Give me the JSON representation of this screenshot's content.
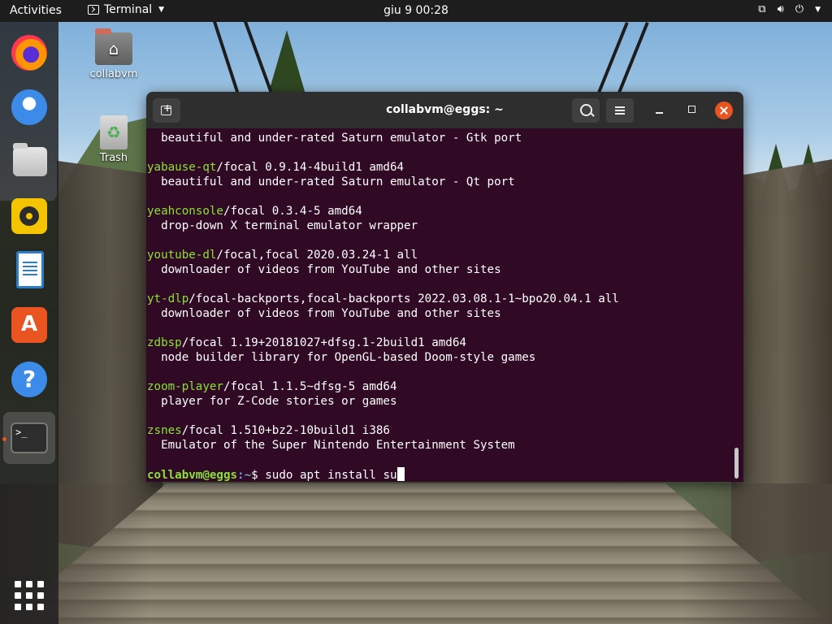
{
  "topbar": {
    "activities": "Activities",
    "app_name": "Terminal",
    "clock": "giu 9  00:28"
  },
  "dock": {
    "items": [
      "firefox-icon",
      "thunderbird-icon",
      "files-icon",
      "rhythmbox-icon",
      "libreoffice-writer-icon",
      "ubuntu-software-icon",
      "help-icon",
      "terminal-icon"
    ],
    "active": "terminal-icon"
  },
  "desktop": {
    "home_label": "collabvm",
    "trash_label": "Trash"
  },
  "terminal": {
    "title": "collabvm@eggs: ~",
    "lines": [
      {
        "pkg": "",
        "rest": "  beautiful and under-rated Saturn emulator - Gtk port"
      },
      {
        "pkg": "",
        "rest": ""
      },
      {
        "pkg": "yabause-qt",
        "rest": "/focal 0.9.14-4build1 amd64"
      },
      {
        "pkg": "",
        "rest": "  beautiful and under-rated Saturn emulator - Qt port"
      },
      {
        "pkg": "",
        "rest": ""
      },
      {
        "pkg": "yeahconsole",
        "rest": "/focal 0.3.4-5 amd64"
      },
      {
        "pkg": "",
        "rest": "  drop-down X terminal emulator wrapper"
      },
      {
        "pkg": "",
        "rest": ""
      },
      {
        "pkg": "youtube-dl",
        "rest": "/focal,focal 2020.03.24-1 all"
      },
      {
        "pkg": "",
        "rest": "  downloader of videos from YouTube and other sites"
      },
      {
        "pkg": "",
        "rest": ""
      },
      {
        "pkg": "yt-dlp",
        "rest": "/focal-backports,focal-backports 2022.03.08.1-1~bpo20.04.1 all"
      },
      {
        "pkg": "",
        "rest": "  downloader of videos from YouTube and other sites"
      },
      {
        "pkg": "",
        "rest": ""
      },
      {
        "pkg": "zdbsp",
        "rest": "/focal 1.19+20181027+dfsg.1-2build1 amd64"
      },
      {
        "pkg": "",
        "rest": "  node builder library for OpenGL-based Doom-style games"
      },
      {
        "pkg": "",
        "rest": ""
      },
      {
        "pkg": "zoom-player",
        "rest": "/focal 1.1.5~dfsg-5 amd64"
      },
      {
        "pkg": "",
        "rest": "  player for Z-Code stories or games"
      },
      {
        "pkg": "",
        "rest": ""
      },
      {
        "pkg": "zsnes",
        "rest": "/focal 1.510+bz2-10build1 i386"
      },
      {
        "pkg": "",
        "rest": "  Emulator of the Super Nintendo Entertainment System"
      },
      {
        "pkg": "",
        "rest": ""
      }
    ],
    "prompt": {
      "user_host": "collabvm@eggs",
      "path": ":~",
      "symbol": "$ ",
      "command": "sudo apt install su"
    }
  },
  "colors": {
    "terminal_bg": "#300a24",
    "package_green": "#8ae234",
    "path_blue": "#729fcf",
    "close_orange": "#e95420"
  }
}
